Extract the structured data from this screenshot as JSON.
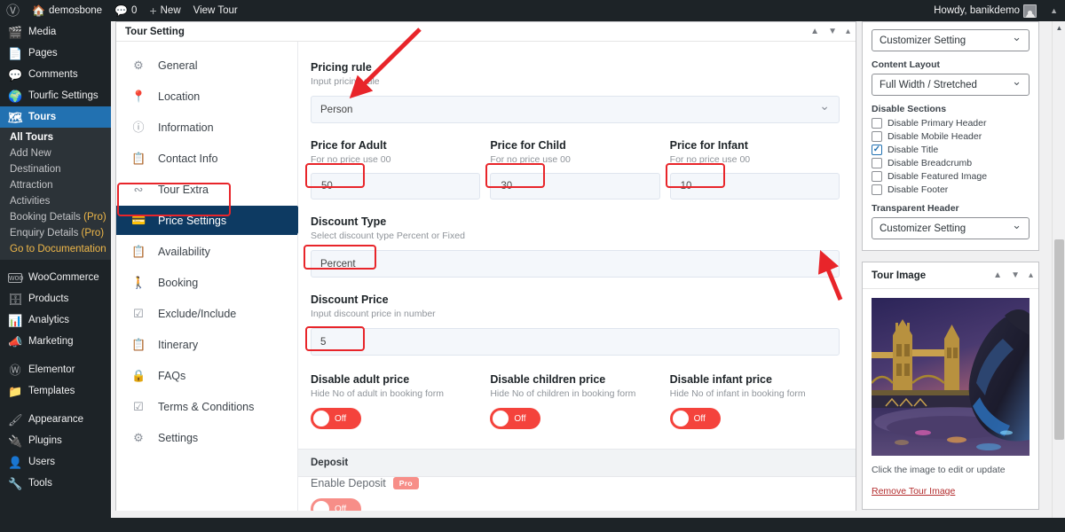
{
  "adminbar": {
    "wp_logo": "wordpress-logo",
    "site_name": "demosbone",
    "comment_count": "0",
    "new_label": "New",
    "view_tour_label": "View Tour",
    "howdy": "Howdy, banikdemo"
  },
  "adminmenu": {
    "items": [
      {
        "label": "Media",
        "icon": "media-icon"
      },
      {
        "label": "Pages",
        "icon": "pages-icon"
      },
      {
        "label": "Comments",
        "icon": "comments-icon"
      },
      {
        "label": "Tourfic Settings",
        "icon": "tourfic-icon"
      },
      {
        "label": "Tours",
        "icon": "tours-icon",
        "current": true
      }
    ],
    "submenu": [
      {
        "label": "All Tours",
        "current": true
      },
      {
        "label": "Add New"
      },
      {
        "label": "Destination"
      },
      {
        "label": "Attraction"
      },
      {
        "label": "Activities"
      },
      {
        "label": "Booking Details",
        "suffix": "(Pro)"
      },
      {
        "label": "Enquiry Details",
        "suffix": "(Pro)"
      },
      {
        "label": "Go to Documentation",
        "doc": true
      }
    ],
    "items_bottom": [
      {
        "label": "WooCommerce",
        "icon": "woocommerce-icon"
      },
      {
        "label": "Products",
        "icon": "products-icon"
      },
      {
        "label": "Analytics",
        "icon": "analytics-icon"
      },
      {
        "label": "Marketing",
        "icon": "marketing-icon"
      },
      {
        "label": "Elementor",
        "icon": "elementor-icon"
      },
      {
        "label": "Templates",
        "icon": "templates-icon"
      },
      {
        "label": "Appearance",
        "icon": "appearance-icon"
      },
      {
        "label": "Plugins",
        "icon": "plugins-icon"
      },
      {
        "label": "Users",
        "icon": "users-icon"
      },
      {
        "label": "Tools",
        "icon": "tools-icon"
      }
    ]
  },
  "tour_setting": {
    "title": "Tour Setting",
    "actions": {
      "up": "▲",
      "down": "▼",
      "toggle": "▴"
    },
    "tabs": [
      {
        "label": "General",
        "icon": "gear-icon"
      },
      {
        "label": "Location",
        "icon": "map-pin-icon"
      },
      {
        "label": "Information",
        "icon": "info-icon"
      },
      {
        "label": "Contact Info",
        "icon": "contact-card-icon"
      },
      {
        "label": "Tour Extra",
        "icon": "share-nodes-icon"
      },
      {
        "label": "Price Settings",
        "icon": "price-card-icon",
        "active": true
      },
      {
        "label": "Availability",
        "icon": "clipboard-icon"
      },
      {
        "label": "Booking",
        "icon": "person-walking-icon"
      },
      {
        "label": "Exclude/Include",
        "icon": "checkbox-icon"
      },
      {
        "label": "Itinerary",
        "icon": "clipboard-list-icon"
      },
      {
        "label": "FAQs",
        "icon": "lock-icon"
      },
      {
        "label": "Terms & Conditions",
        "icon": "checkbox-outline-icon"
      },
      {
        "label": "Settings",
        "icon": "gears-icon"
      }
    ]
  },
  "price_panel": {
    "pricing_rule": {
      "label": "Pricing rule",
      "desc": "Input pricing rule",
      "value": "Person"
    },
    "price_adult": {
      "label": "Price for Adult",
      "desc": "For no price use 00",
      "value": "50"
    },
    "price_child": {
      "label": "Price for Child",
      "desc": "For no price use 00",
      "value": "30"
    },
    "price_infant": {
      "label": "Price for Infant",
      "desc": "For no price use 00",
      "value": "10"
    },
    "discount_type": {
      "label": "Discount Type",
      "desc": "Select discount type Percent or Fixed",
      "value": "Percent"
    },
    "discount_price": {
      "label": "Discount Price",
      "desc": "Input discount price in number",
      "value": "5"
    },
    "disable_adult": {
      "label": "Disable adult price",
      "desc": "Hide No of adult in booking form",
      "state": "Off"
    },
    "disable_children": {
      "label": "Disable children price",
      "desc": "Hide No of children in booking form",
      "state": "Off"
    },
    "disable_infant": {
      "label": "Disable infant price",
      "desc": "Hide No of infant in booking form",
      "state": "Off"
    },
    "deposit": {
      "section_title": "Deposit",
      "enable_label": "Enable Deposit",
      "pro_badge": "Pro",
      "state": "Off"
    }
  },
  "sidebar_right": {
    "sidebar_select": {
      "value": "Customizer Setting"
    },
    "content_layout": {
      "label": "Content Layout",
      "value": "Full Width / Stretched"
    },
    "disable_sections": {
      "label": "Disable Sections",
      "items": [
        {
          "label": "Disable Primary Header",
          "checked": false
        },
        {
          "label": "Disable Mobile Header",
          "checked": false
        },
        {
          "label": "Disable Title",
          "checked": true
        },
        {
          "label": "Disable Breadcrumb",
          "checked": false
        },
        {
          "label": "Disable Featured Image",
          "checked": false
        },
        {
          "label": "Disable Footer",
          "checked": false
        }
      ]
    },
    "transparent_header": {
      "label": "Transparent Header",
      "value": "Customizer Setting"
    },
    "tour_image": {
      "title": "Tour Image",
      "caption": "Click the image to edit or update",
      "remove_link": "Remove Tour Image",
      "alt": "tower-bridge-dolphin-fountain-night"
    }
  },
  "colors": {
    "wp_dark": "#1d2327",
    "wp_blue": "#2271b1",
    "tab_active": "#0d3a62",
    "toggle_off_red": "#f4433c",
    "toggle_disabled": "#f78e88",
    "annotation_red": "#e8252a",
    "doc_gold": "#f0b849"
  }
}
